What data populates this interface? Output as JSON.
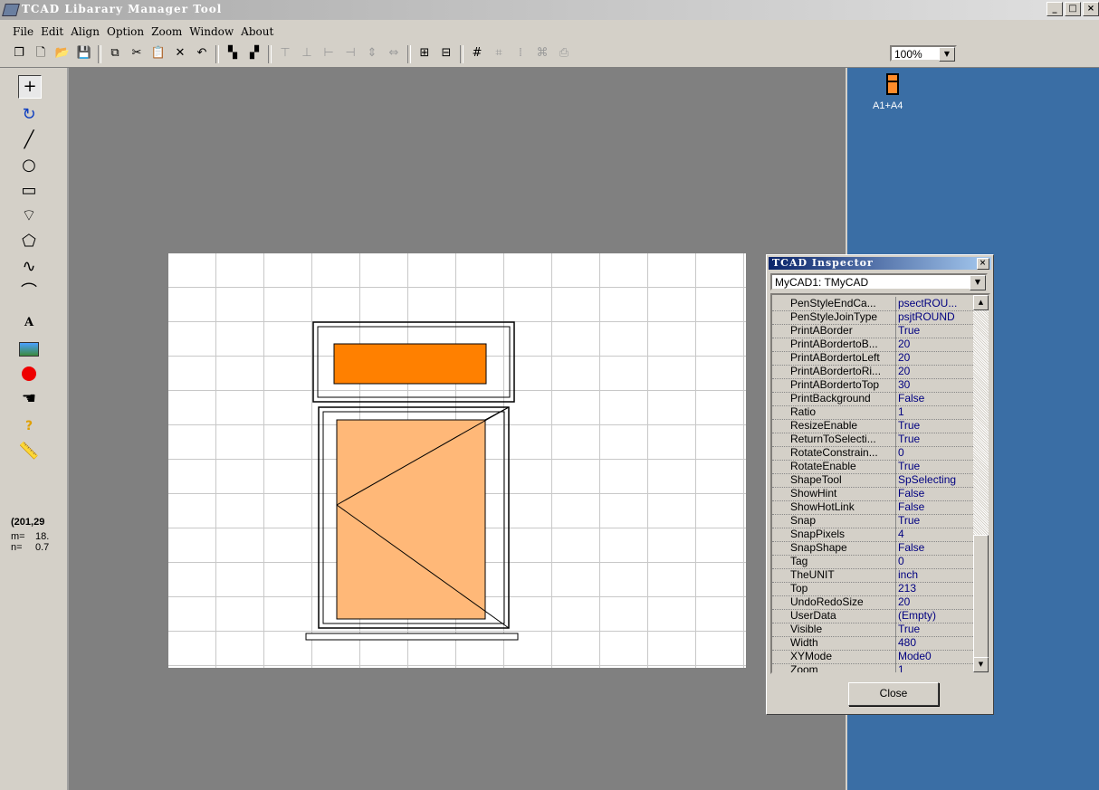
{
  "window": {
    "title": "TCAD Libarary Manager Tool",
    "min": "_",
    "max": "□",
    "close": "×"
  },
  "menu": [
    "File",
    "Edit",
    "Align",
    "Option",
    "Zoom",
    "Window",
    "About"
  ],
  "toolbar": {
    "zoom": "100%"
  },
  "status": {
    "coords": "(201,29",
    "m_label": "m=",
    "m_value": "18.",
    "n_label": "n=",
    "n_value": "0.7"
  },
  "library": {
    "item_label": "A1+A4"
  },
  "inspector": {
    "title": "TCAD Inspector",
    "object": "MyCAD1: TMyCAD",
    "close_button": "Close",
    "properties": [
      {
        "name": "PenStyleEndCa...",
        "value": "psectROU..."
      },
      {
        "name": "PenStyleJoinType",
        "value": "psjtROUND"
      },
      {
        "name": "PrintABorder",
        "value": "True"
      },
      {
        "name": "PrintABordertoB...",
        "value": "20"
      },
      {
        "name": "PrintABordertoLeft",
        "value": "20"
      },
      {
        "name": "PrintABordertoRi...",
        "value": "20"
      },
      {
        "name": "PrintABordertoTop",
        "value": "30"
      },
      {
        "name": "PrintBackground",
        "value": "False"
      },
      {
        "name": "Ratio",
        "value": "1"
      },
      {
        "name": "ResizeEnable",
        "value": "True"
      },
      {
        "name": "ReturnToSelecti...",
        "value": "True"
      },
      {
        "name": "RotateConstrain...",
        "value": "0"
      },
      {
        "name": "RotateEnable",
        "value": "True"
      },
      {
        "name": "ShapeTool",
        "value": "SpSelecting"
      },
      {
        "name": "ShowHint",
        "value": "False"
      },
      {
        "name": "ShowHotLink",
        "value": "False"
      },
      {
        "name": "Snap",
        "value": "True"
      },
      {
        "name": "SnapPixels",
        "value": "4"
      },
      {
        "name": "SnapShape",
        "value": "False"
      },
      {
        "name": "Tag",
        "value": "0"
      },
      {
        "name": "TheUNIT",
        "value": "inch"
      },
      {
        "name": "Top",
        "value": "213"
      },
      {
        "name": "UndoRedoSize",
        "value": "20"
      },
      {
        "name": "UserData",
        "value": "(Empty)"
      },
      {
        "name": "Visible",
        "value": "True"
      },
      {
        "name": "Width",
        "value": "480"
      },
      {
        "name": "XYMode",
        "value": "Mode0"
      },
      {
        "name": "Zoom",
        "value": "1"
      }
    ]
  },
  "colors": {
    "glass_top": "#ff8000",
    "glass_main": "#ffb878",
    "desktop_panel": "#3a6ea5",
    "workspace": "#808080"
  }
}
